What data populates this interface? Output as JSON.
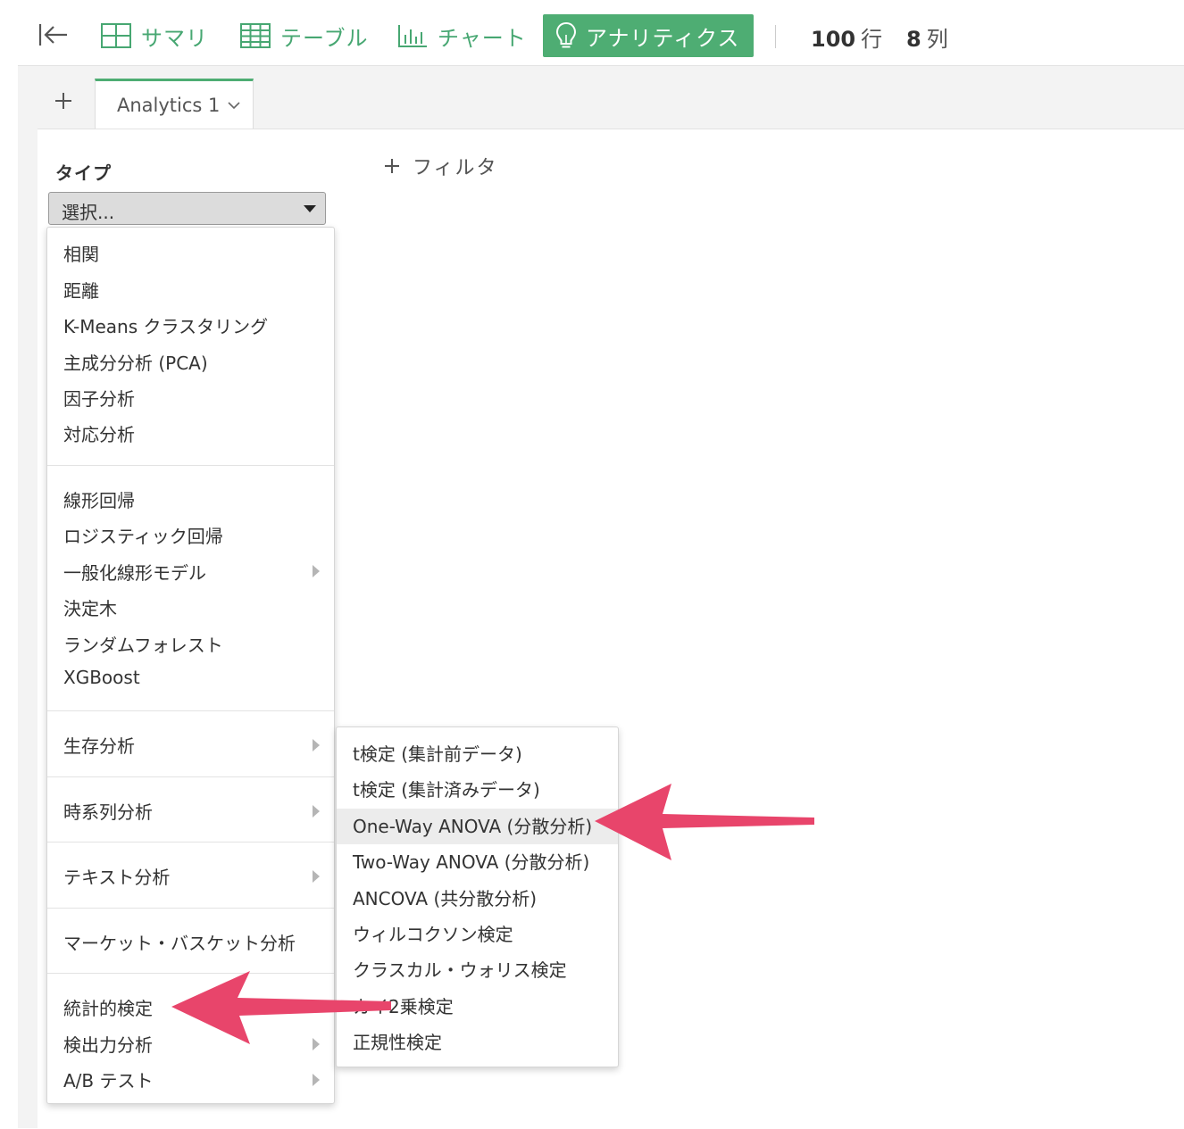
{
  "toolbar": {
    "items": [
      {
        "label": "サマリ",
        "icon": "summary-grid-icon"
      },
      {
        "label": "テーブル",
        "icon": "table-icon"
      },
      {
        "label": "チャート",
        "icon": "bar-chart-icon"
      },
      {
        "label": "アナリティクス",
        "icon": "lightbulb-icon",
        "active": true
      }
    ],
    "rows_count": "100",
    "rows_unit": "行",
    "cols_count": "8",
    "cols_unit": "列"
  },
  "tabs": [
    {
      "label": "Analytics 1",
      "active": true
    }
  ],
  "form": {
    "type_label": "タイプ",
    "select_value": "選択...",
    "filter_label": "フィルタ"
  },
  "menu": {
    "groups": [
      {
        "items": [
          {
            "label": "相関"
          },
          {
            "label": "距離"
          },
          {
            "label": "K-Means クラスタリング"
          },
          {
            "label": "主成分分析 (PCA)"
          },
          {
            "label": "因子分析"
          },
          {
            "label": "対応分析"
          }
        ]
      },
      {
        "items": [
          {
            "label": "線形回帰"
          },
          {
            "label": "ロジスティック回帰"
          },
          {
            "label": "一般化線形モデル",
            "submenu": true
          },
          {
            "label": "決定木"
          },
          {
            "label": "ランダムフォレスト"
          },
          {
            "label": "XGBoost"
          }
        ]
      },
      {
        "items": [
          {
            "label": "生存分析",
            "submenu": true
          }
        ]
      },
      {
        "items": [
          {
            "label": "時系列分析",
            "submenu": true
          }
        ]
      },
      {
        "items": [
          {
            "label": "テキスト分析",
            "submenu": true
          }
        ]
      },
      {
        "items": [
          {
            "label": "マーケット・バスケット分析"
          }
        ]
      },
      {
        "items": [
          {
            "label": "統計的検定",
            "submenu": true,
            "open": true
          },
          {
            "label": "検出力分析",
            "submenu": true
          },
          {
            "label": "A/B テスト",
            "submenu": true
          }
        ]
      }
    ]
  },
  "submenu": {
    "items": [
      {
        "label": "t検定 (集計前データ)"
      },
      {
        "label": "t検定 (集計済みデータ)"
      },
      {
        "label": "One-Way ANOVA (分散分析)",
        "highlighted": true
      },
      {
        "label": "Two-Way ANOVA (分散分析)"
      },
      {
        "label": "ANCOVA (共分散分析)"
      },
      {
        "label": "ウィルコクソン検定"
      },
      {
        "label": "クラスカル・ウォリス検定"
      },
      {
        "label": "カイ2乗検定"
      },
      {
        "label": "正規性検定"
      }
    ]
  },
  "colors": {
    "accent": "#4ead73",
    "annotation_arrow": "#e8456b"
  }
}
